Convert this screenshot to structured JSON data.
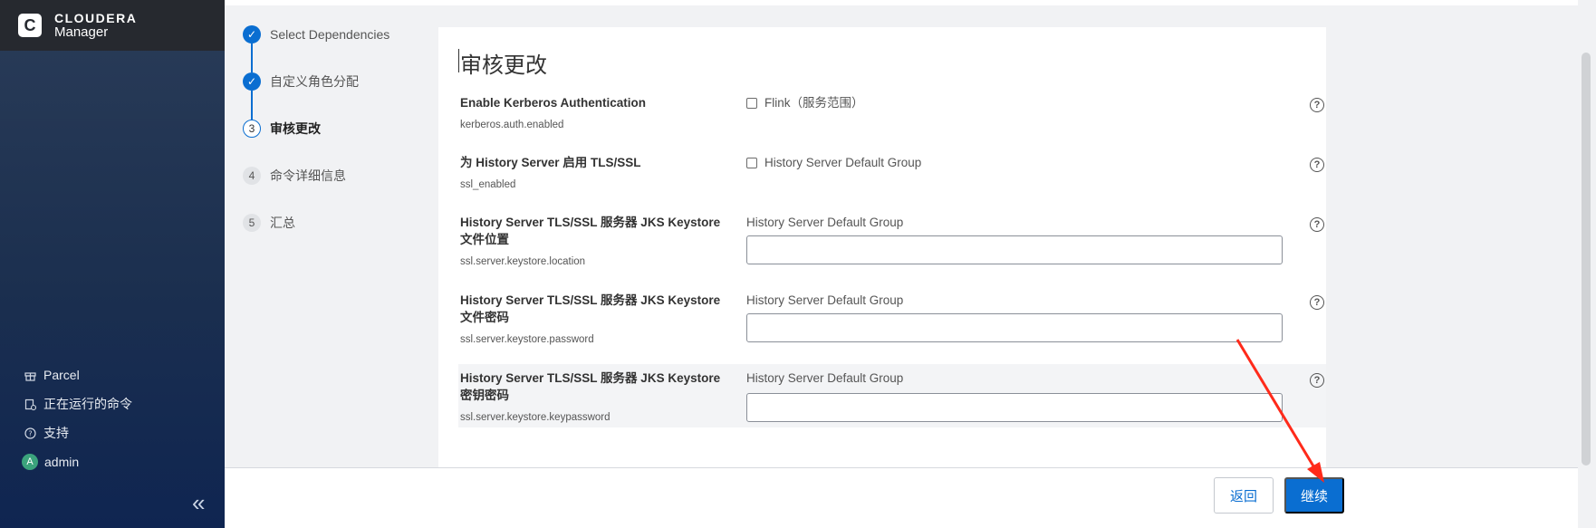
{
  "brand": {
    "logo_letter": "C",
    "line1": "CLOUDERA",
    "line2": "Manager"
  },
  "sidebar": {
    "links": [
      {
        "icon": "gift-icon",
        "label": "Parcel"
      },
      {
        "icon": "commands-icon",
        "label": "正在运行的命令"
      },
      {
        "icon": "help-circle-icon",
        "label": "支持"
      },
      {
        "icon": "avatar",
        "avatar_letter": "A",
        "label": "admin"
      }
    ],
    "collapse_glyph": "«"
  },
  "steps": [
    {
      "num": "✓",
      "label": "Select Dependencies",
      "state": "done"
    },
    {
      "num": "✓",
      "label": "自定义角色分配",
      "state": "done"
    },
    {
      "num": "3",
      "label": "审核更改",
      "state": "current"
    },
    {
      "num": "4",
      "label": "命令详细信息",
      "state": "todo"
    },
    {
      "num": "5",
      "label": "汇总",
      "state": "todo"
    }
  ],
  "page": {
    "title": "审核更改"
  },
  "config": [
    {
      "name": "Enable Kerberos Authentication",
      "key": "kerberos.auth.enabled",
      "type": "checkbox",
      "value": "Flink（服务范围）",
      "checked": false
    },
    {
      "name": "为 History Server 启用 TLS/SSL",
      "key": "ssl_enabled",
      "type": "checkbox",
      "value": "History Server Default Group",
      "checked": false
    },
    {
      "name": "History Server TLS/SSL 服务器 JKS Keystore 文件位置",
      "key": "ssl.server.keystore.location",
      "type": "text",
      "group": "History Server Default Group",
      "input_value": ""
    },
    {
      "name": "History Server TLS/SSL 服务器 JKS Keystore 文件密码",
      "key": "ssl.server.keystore.password",
      "type": "text",
      "group": "History Server Default Group",
      "input_value": ""
    },
    {
      "name": "History Server TLS/SSL 服务器 JKS Keystore 密钥密码",
      "key": "ssl.server.keystore.keypassword",
      "type": "text",
      "group": "History Server Default Group",
      "input_value": ""
    }
  ],
  "help_glyph": "?",
  "footer": {
    "back_label": "返回",
    "next_label": "继续"
  },
  "colors": {
    "primary": "#0a6ed1",
    "sidebar_dark": "#1b2f4f",
    "annotation_arrow": "#ff2a1a"
  }
}
